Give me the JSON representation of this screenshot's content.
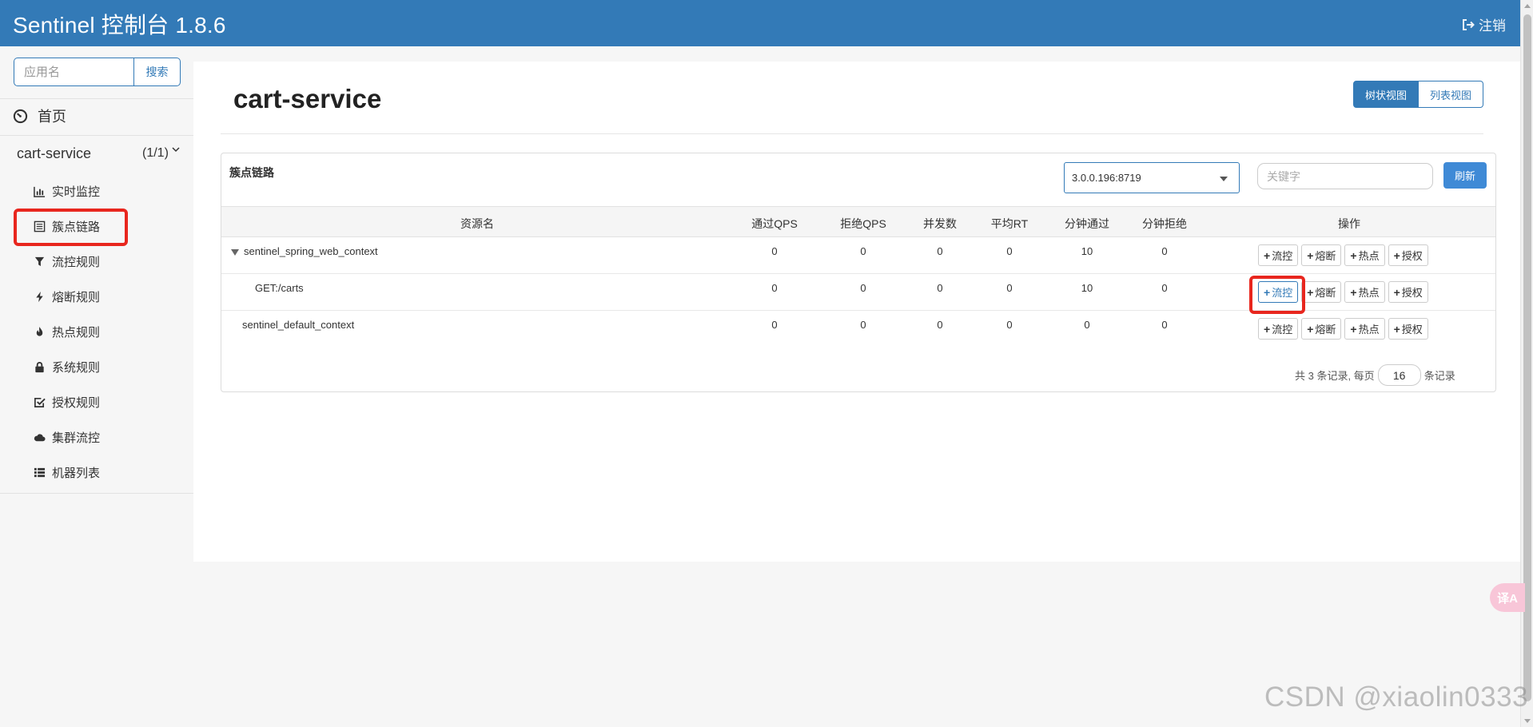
{
  "header": {
    "title": "Sentinel 控制台 1.8.6",
    "logout_label": "注销"
  },
  "sidebar": {
    "search_placeholder": "应用名",
    "search_button": "搜索",
    "home_label": "首页",
    "app": {
      "name": "cart-service",
      "count": "(1/1)"
    },
    "items": [
      {
        "label": "实时监控",
        "icon": "bar-chart-icon"
      },
      {
        "label": "簇点链路",
        "icon": "list-icon"
      },
      {
        "label": "流控规则",
        "icon": "filter-icon"
      },
      {
        "label": "熔断规则",
        "icon": "bolt-icon"
      },
      {
        "label": "热点规则",
        "icon": "fire-icon"
      },
      {
        "label": "系统规则",
        "icon": "lock-icon"
      },
      {
        "label": "授权规则",
        "icon": "check-square-icon"
      },
      {
        "label": "集群流控",
        "icon": "cloud-icon"
      },
      {
        "label": "机器列表",
        "icon": "list-ul-icon"
      }
    ]
  },
  "main": {
    "title": "cart-service",
    "view_tree": "树状视图",
    "view_list": "列表视图",
    "panel_title": "簇点链路",
    "machine": "3.0.0.196:8719",
    "keyword_placeholder": "关键字",
    "refresh": "刷新",
    "columns": [
      "资源名",
      "通过QPS",
      "拒绝QPS",
      "并发数",
      "平均RT",
      "分钟通过",
      "分钟拒绝",
      "操作"
    ],
    "rows": [
      {
        "name": "sentinel_spring_web_context",
        "pass_qps": "0",
        "block_qps": "0",
        "concurrency": "0",
        "avg_rt": "0",
        "minute_pass": "10",
        "minute_block": "0"
      },
      {
        "name": "GET:/carts",
        "pass_qps": "0",
        "block_qps": "0",
        "concurrency": "0",
        "avg_rt": "0",
        "minute_pass": "10",
        "minute_block": "0"
      },
      {
        "name": "sentinel_default_context",
        "pass_qps": "0",
        "block_qps": "0",
        "concurrency": "0",
        "avg_rt": "0",
        "minute_pass": "0",
        "minute_block": "0"
      }
    ],
    "ops": {
      "flow": "流控",
      "degrade": "熔断",
      "hotspot": "热点",
      "authority": "授权"
    },
    "pager": {
      "prefix": "共 3 条记录, 每页",
      "page_size": "16",
      "suffix": "条记录"
    }
  },
  "overlay": {
    "translate": "译A",
    "watermark": "CSDN @xiaolin0333"
  },
  "colors": {
    "primary": "#337ab7",
    "highlight": "#e8261e"
  }
}
